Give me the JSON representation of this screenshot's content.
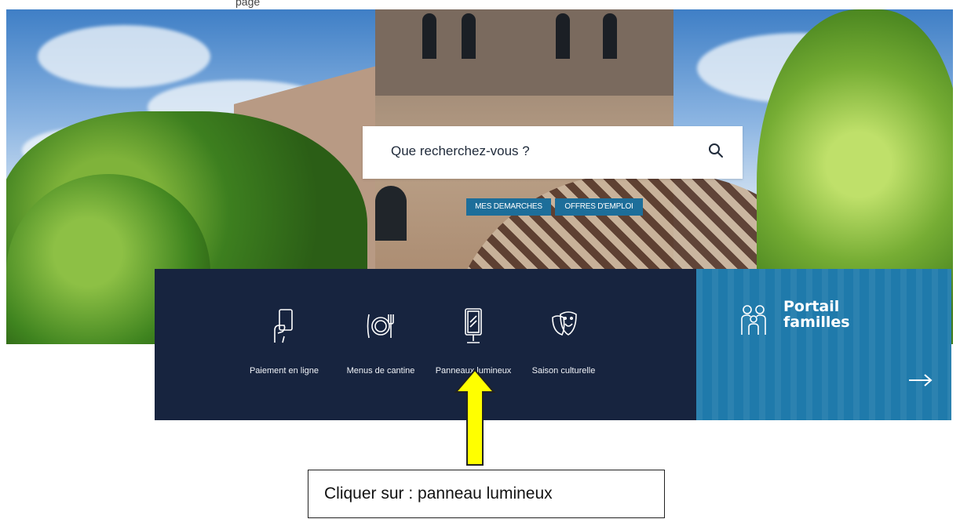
{
  "header": {
    "top_fragment": "page"
  },
  "search": {
    "placeholder": "Que recherchez-vous ?",
    "icon": "search-icon"
  },
  "quick_links": [
    {
      "label": "MES DEMARCHES"
    },
    {
      "label": "OFFRES D'EMPLOI"
    }
  ],
  "services": [
    {
      "label": "Paiement en ligne",
      "icon": "card-payment-icon"
    },
    {
      "label": "Menus de cantine",
      "icon": "plate-cutlery-icon"
    },
    {
      "label": "Panneaux lumineux",
      "icon": "digital-sign-icon"
    },
    {
      "label": "Saison culturelle",
      "icon": "theater-masks-icon"
    }
  ],
  "portal": {
    "title_line1": "Portail",
    "title_line2": "familles",
    "icon": "family-icon",
    "arrow_icon": "arrow-right-icon"
  },
  "annotation": {
    "callout_text": "Cliquer sur : panneau lumineux",
    "arrow_icon": "yellow-pointer-arrow"
  },
  "colors": {
    "navy_panel": "#17243f",
    "portal_blue": "#1f7aab",
    "pill_blue": "#1d6e9a",
    "arrow_yellow": "#ffff00"
  }
}
